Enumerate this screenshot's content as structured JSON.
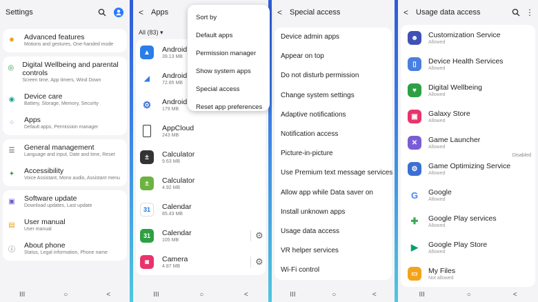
{
  "settings": {
    "title": "Settings",
    "items": [
      {
        "label": "Advanced features",
        "sub": "Motions and gestures, One-handed mode"
      },
      {
        "label": "Digital Wellbeing and parental controls",
        "sub": "Screen time, App timers, Wind Down"
      },
      {
        "label": "Device care",
        "sub": "Battery, Storage, Memory, Security"
      },
      {
        "label": "Apps",
        "sub": "Default apps, Permission manager"
      },
      {
        "label": "General management",
        "sub": "Language and input, Date and time, Reset"
      },
      {
        "label": "Accessibility",
        "sub": "Voice Assistant, Mono audio, Assistant menu"
      },
      {
        "label": "Software update",
        "sub": "Download updates, Last update"
      },
      {
        "label": "User manual",
        "sub": "User manual"
      },
      {
        "label": "About phone",
        "sub": "Status, Legal information, Phone name"
      }
    ]
  },
  "apps": {
    "title": "Apps",
    "filter": "All (83)",
    "items": [
      {
        "name": "Android A",
        "size": "39.13 MB"
      },
      {
        "name": "Android A",
        "size": "72.85 MB"
      },
      {
        "name": "Android System WebView",
        "size": "179 MB"
      },
      {
        "name": "AppCloud",
        "size": "243 MB"
      },
      {
        "name": "Calculator",
        "size": "9.63 MB"
      },
      {
        "name": "Calculator",
        "size": "4.92 MB"
      },
      {
        "name": "Calendar",
        "size": "85.43 MB"
      },
      {
        "name": "Calendar",
        "size": "105 MB"
      },
      {
        "name": "Camera",
        "size": "4.87 MB"
      }
    ],
    "menu": [
      "Sort by",
      "Default apps",
      "Permission manager",
      "Show system apps",
      "Special access",
      "Reset app preferences"
    ]
  },
  "special_access": {
    "title": "Special access",
    "items": [
      "Device admin apps",
      "Appear on top",
      "Do not disturb permission",
      "Change system settings",
      "Adaptive notifications",
      "Notification access",
      "Picture-in-picture",
      "Use Premium text message services",
      "Allow app while Data saver on",
      "Install unknown apps",
      "Usage data access",
      "VR helper services",
      "Wi-Fi control"
    ]
  },
  "usage": {
    "title": "Usage data access",
    "disabled_label": "Disabled",
    "items": [
      {
        "name": "Customization Service",
        "status": "Allowed",
        "color": "#3f51b5"
      },
      {
        "name": "Device Health Services",
        "status": "Allowed",
        "color": "#4a7fe0"
      },
      {
        "name": "Digital Wellbeing",
        "status": "Allowed",
        "color": "#2ea043"
      },
      {
        "name": "Galaxy Store",
        "status": "Allowed",
        "color": "#e8336d"
      },
      {
        "name": "Game Launcher",
        "status": "Allowed",
        "color": "#7b5cd6"
      },
      {
        "name": "Game Optimizing Service",
        "status": "Allowed",
        "color": "#3c6fd6"
      },
      {
        "name": "Google",
        "status": "Allowed",
        "color": "#ffffff"
      },
      {
        "name": "Google Play services",
        "status": "Allowed",
        "color": "#ffffff"
      },
      {
        "name": "Google Play Store",
        "status": "Allowed",
        "color": "#ffffff"
      },
      {
        "name": "My Files",
        "status": "Not allowed",
        "color": "#f2a41c"
      }
    ]
  },
  "navbar": {
    "recents": "III",
    "home": "○",
    "back": "<"
  }
}
